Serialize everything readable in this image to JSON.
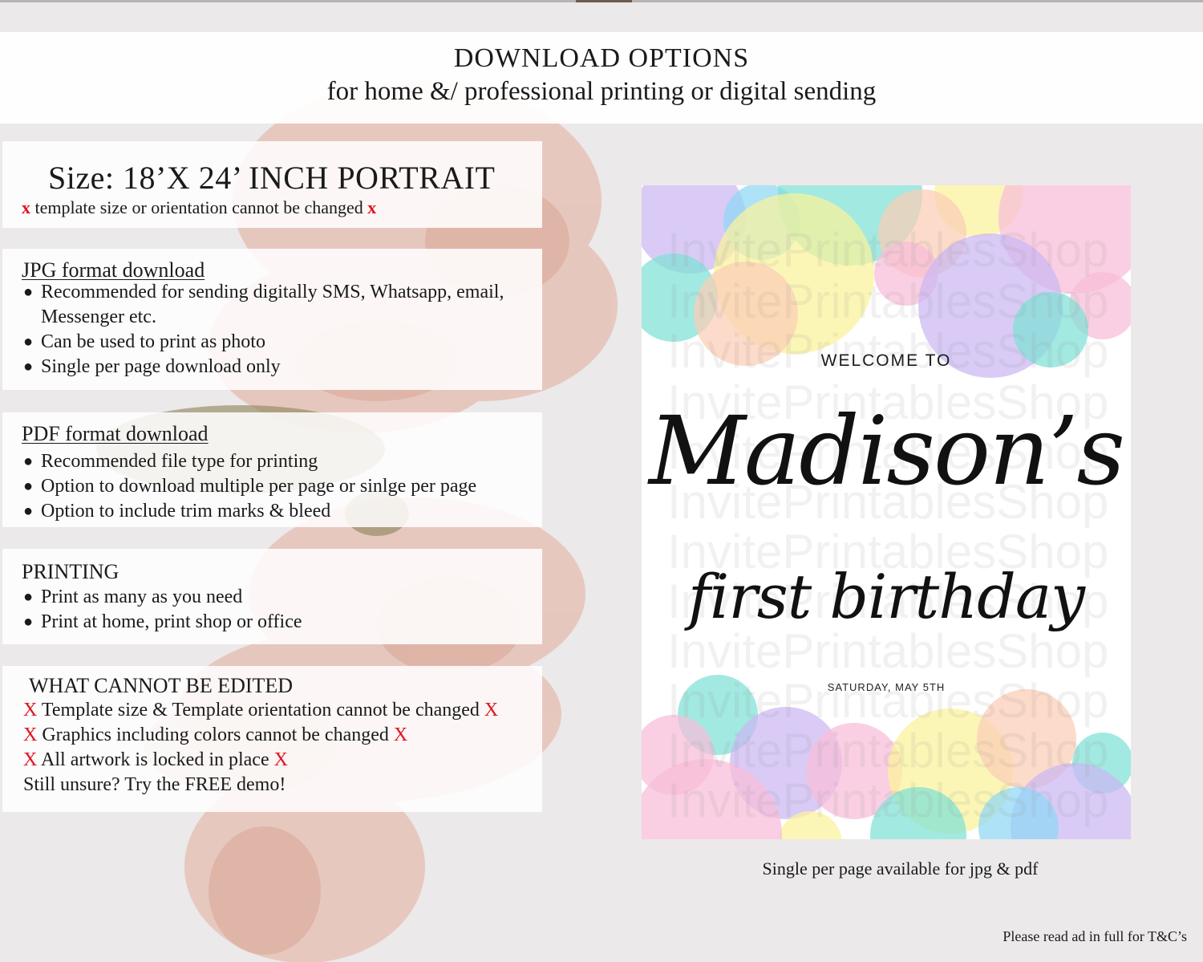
{
  "header": {
    "title": "DOWNLOAD OPTIONS",
    "subtitle": "for home &/ professional printing or digital sending"
  },
  "size": {
    "heading": "Size: 18’X 24’ INCH PORTRAIT",
    "note": "template size or orientation cannot be changed",
    "marker": "x"
  },
  "jpg": {
    "title": "JPG format download",
    "bullets": [
      "Recommended for sending digitally SMS, Whatsapp, email, Messenger etc.",
      "Can be used to print as photo",
      "Single per page download only"
    ]
  },
  "pdf": {
    "title": "PDF format download",
    "bullets": [
      "Recommended file type for printing",
      "Option to download multiple per page or sinlge per page",
      "Option to include trim marks & bleed"
    ]
  },
  "printing": {
    "title": "PRINTING",
    "bullets": [
      "Print as many as you need",
      "Print at home, print shop or office"
    ]
  },
  "not_editable": {
    "title": "WHAT CANNOT BE EDITED",
    "marker": "X",
    "items": [
      "Template size & Template orientation cannot be changed",
      "Graphics including colors cannot be changed",
      "All artwork is locked in place"
    ],
    "closing": "Still unsure? Try the FREE demo!"
  },
  "preview": {
    "welcome": "WELCOME TO",
    "name": "Madison’s",
    "occasion": "first birthday",
    "date": "SATURDAY, MAY 5TH",
    "watermark": "InvitePrintablesShop",
    "palette": [
      "#cbb7f2",
      "#7ee0d6",
      "#fbf29a",
      "#fbcdb5",
      "#f8bcd8",
      "#8fd7f4"
    ]
  },
  "caption": "Single per page available for jpg & pdf",
  "footer_note": "Please read ad in full for T&C’s"
}
